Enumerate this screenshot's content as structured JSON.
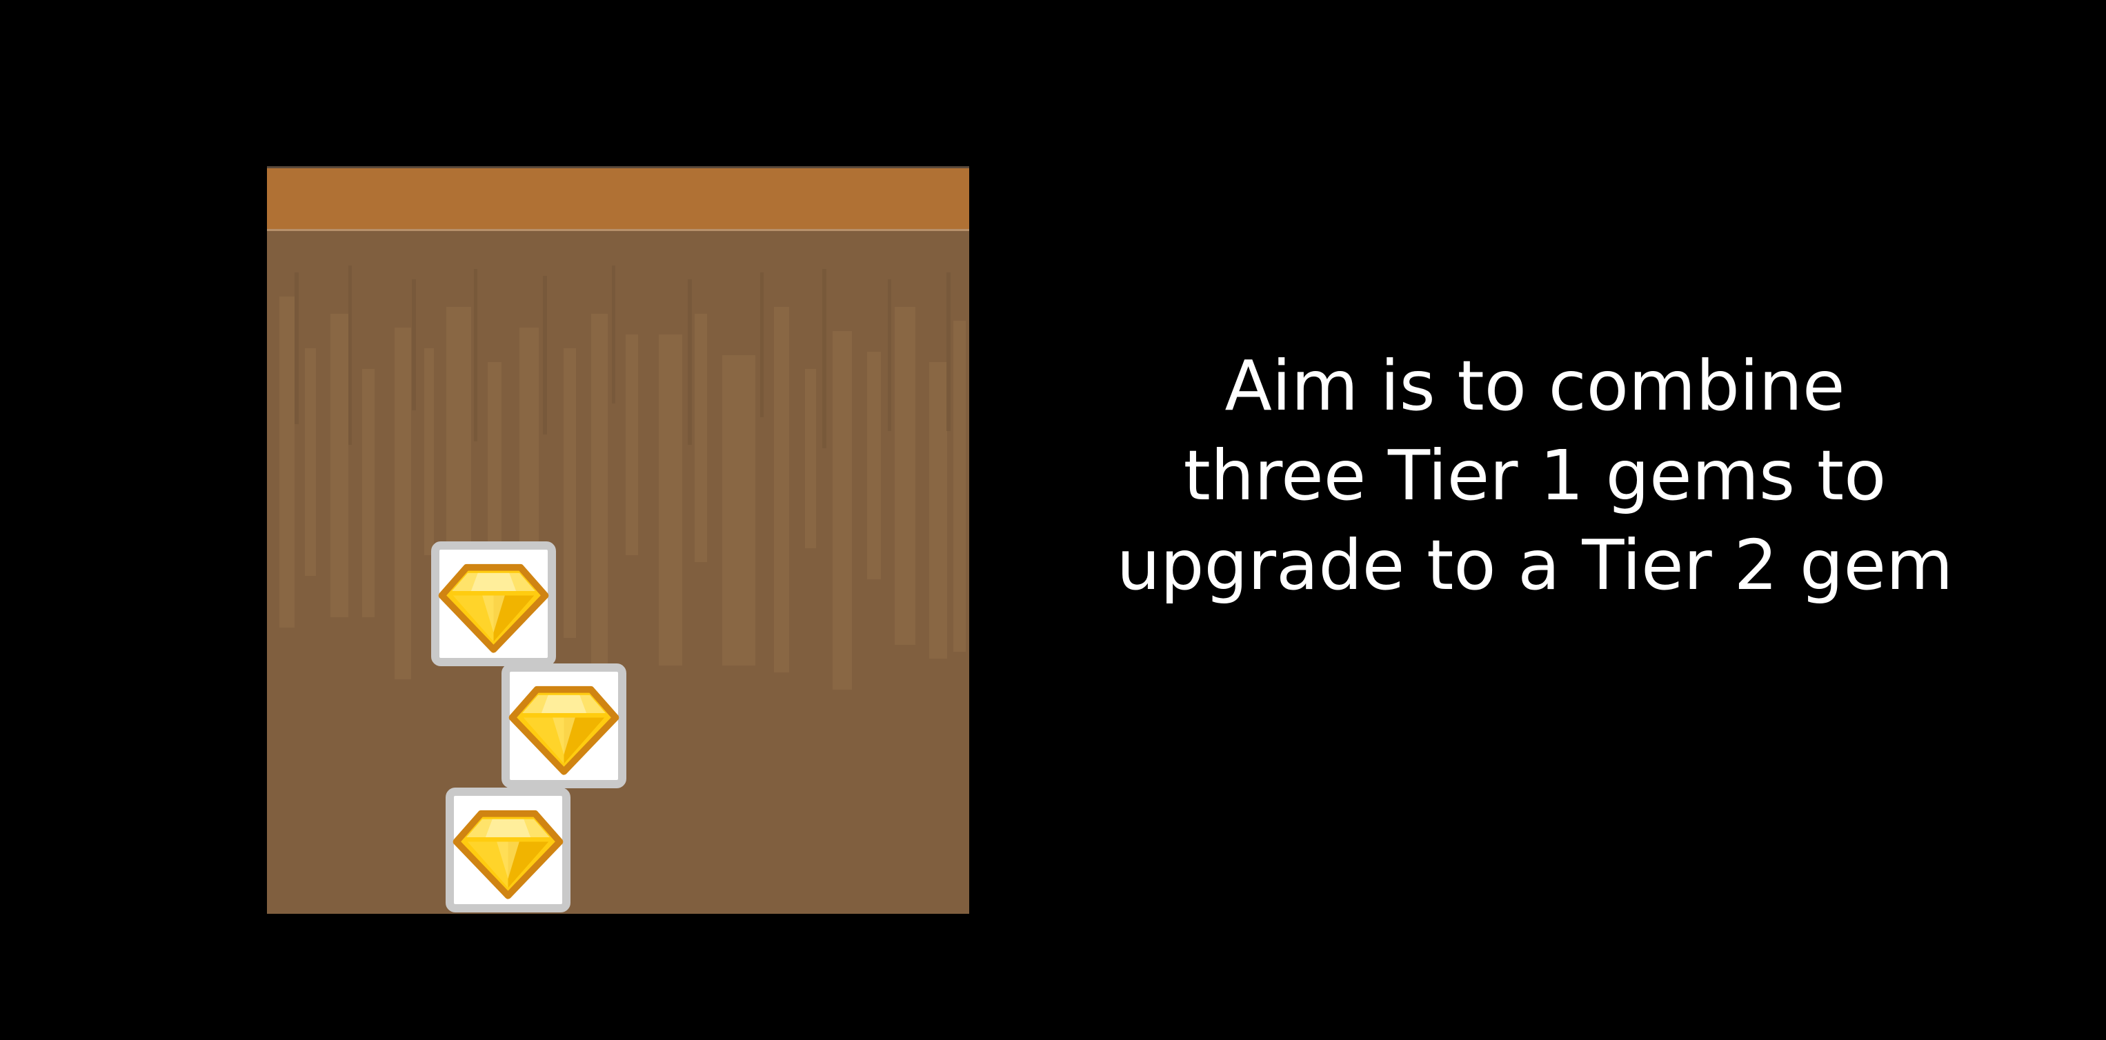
{
  "board": {
    "top_bar_color": "#b07134",
    "ground_color": "#805f3f",
    "gems": [
      {
        "tier": 1,
        "icon": "yellow-diamond-gem-icon",
        "color": "#ffcc10"
      },
      {
        "tier": 1,
        "icon": "yellow-diamond-gem-icon",
        "color": "#ffcc10"
      },
      {
        "tier": 1,
        "icon": "yellow-diamond-gem-icon",
        "color": "#ffcc10"
      }
    ]
  },
  "instruction": {
    "lines": [
      "Aim is to combine",
      "three Tier 1 gems to",
      "upgrade to a Tier 2 gem"
    ]
  }
}
